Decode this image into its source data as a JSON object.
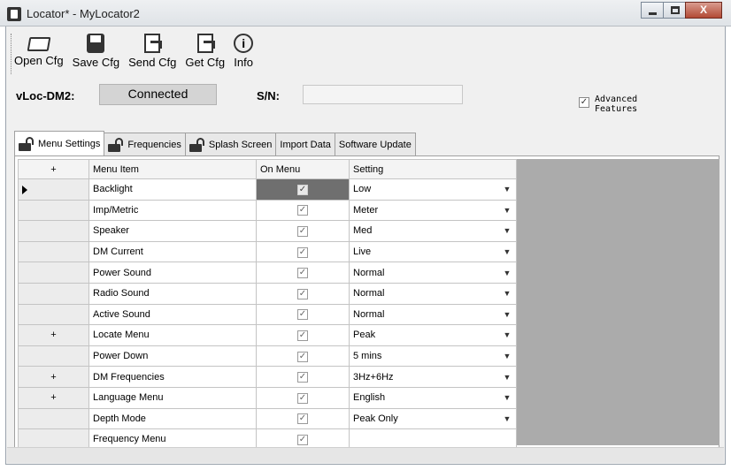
{
  "window": {
    "title": "Locator* - MyLocator2",
    "close_label": "X"
  },
  "toolbar": {
    "buttons": [
      {
        "label": "Open Cfg",
        "icon": "open-folder-icon"
      },
      {
        "label": "Save Cfg",
        "icon": "save-disk-icon"
      },
      {
        "label": "Send Cfg",
        "icon": "send-document-icon"
      },
      {
        "label": "Get Cfg",
        "icon": "get-document-icon"
      },
      {
        "label": "Info",
        "icon": "info-icon"
      }
    ]
  },
  "device": {
    "name_label": "vLoc-DM2:",
    "status": "Connected",
    "sn_label": "S/N:",
    "sn_value": ""
  },
  "advanced": {
    "label": "Advanced Features",
    "checked": true,
    "check_glyph": "✓"
  },
  "tabs": [
    {
      "label": "Menu Settings",
      "locked": true,
      "active": true
    },
    {
      "label": "Frequencies",
      "locked": true,
      "active": false
    },
    {
      "label": "Splash Screen",
      "locked": true,
      "active": false
    },
    {
      "label": "Import Data",
      "locked": false,
      "active": false
    },
    {
      "label": "Software Update",
      "locked": false,
      "active": false
    }
  ],
  "grid": {
    "headers": {
      "expander": "+",
      "menu_item": "Menu Item",
      "on_menu": "On Menu",
      "setting": "Setting"
    },
    "check_glyph": "✓",
    "dropdown_glyph": "▼",
    "rows": [
      {
        "expander": "",
        "item": "Backlight",
        "on_menu": true,
        "setting": "Low",
        "has_dropdown": true,
        "current": true
      },
      {
        "expander": "",
        "item": "Imp/Metric",
        "on_menu": true,
        "setting": "Meter",
        "has_dropdown": true
      },
      {
        "expander": "",
        "item": "Speaker",
        "on_menu": true,
        "setting": "Med",
        "has_dropdown": true
      },
      {
        "expander": "",
        "item": "DM Current",
        "on_menu": true,
        "setting": "Live",
        "has_dropdown": true
      },
      {
        "expander": "",
        "item": "Power Sound",
        "on_menu": true,
        "setting": "Normal",
        "has_dropdown": true
      },
      {
        "expander": "",
        "item": "Radio Sound",
        "on_menu": true,
        "setting": "Normal",
        "has_dropdown": true
      },
      {
        "expander": "",
        "item": "Active Sound",
        "on_menu": true,
        "setting": "Normal",
        "has_dropdown": true
      },
      {
        "expander": "+",
        "item": "Locate Menu",
        "on_menu": true,
        "setting": "Peak",
        "has_dropdown": true
      },
      {
        "expander": "",
        "item": "Power Down",
        "on_menu": true,
        "setting": "5 mins",
        "has_dropdown": true
      },
      {
        "expander": "+",
        "item": "DM Frequencies",
        "on_menu": true,
        "setting": "3Hz+6Hz",
        "has_dropdown": true
      },
      {
        "expander": "+",
        "item": "Language Menu",
        "on_menu": true,
        "setting": "English",
        "has_dropdown": true
      },
      {
        "expander": "",
        "item": "Depth Mode",
        "on_menu": true,
        "setting": "Peak Only",
        "has_dropdown": true
      },
      {
        "expander": "",
        "item": "Frequency Menu",
        "on_menu": true,
        "setting": "",
        "has_dropdown": false
      }
    ]
  }
}
